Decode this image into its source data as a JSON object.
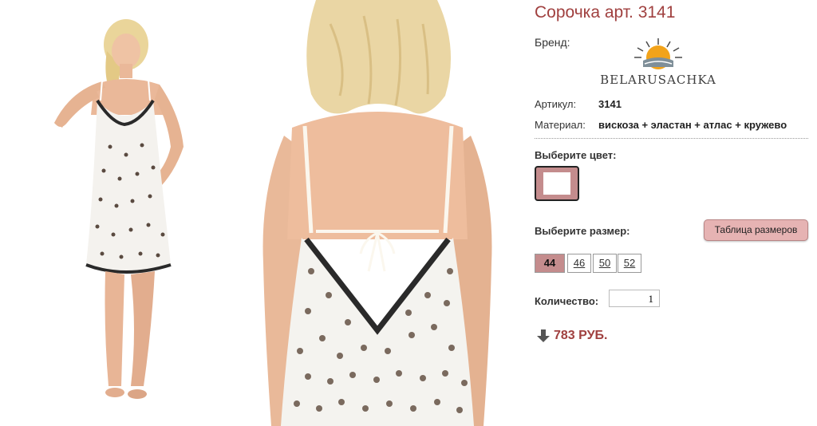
{
  "product": {
    "title": "Сорочка арт. 3141",
    "brand_label": "Бренд:",
    "brand_name": "BELARUSACHKA",
    "specs": [
      {
        "label": "Артикул:",
        "value": "3141"
      },
      {
        "label": "Материал:",
        "value": "вискоза + эластан + атлас + кружево"
      }
    ]
  },
  "color_picker": {
    "label": "Выберите цвет:",
    "selected_color": "#c48c8d"
  },
  "size_picker": {
    "label": "Выберите размер:",
    "size_table_button": "Таблица размеров",
    "sizes": [
      "44",
      "46",
      "50",
      "52"
    ],
    "selected": "44"
  },
  "quantity": {
    "label": "Количество:",
    "value": "1"
  },
  "price": {
    "text": "783 РУБ."
  },
  "colors": {
    "accent": "#a0403f",
    "swatch_active": "#c48c8d",
    "button_bg": "#e6b3b3"
  },
  "icons": {
    "price_arrow": "arrow-down-icon",
    "brand_logo": "sun-logo-icon"
  }
}
